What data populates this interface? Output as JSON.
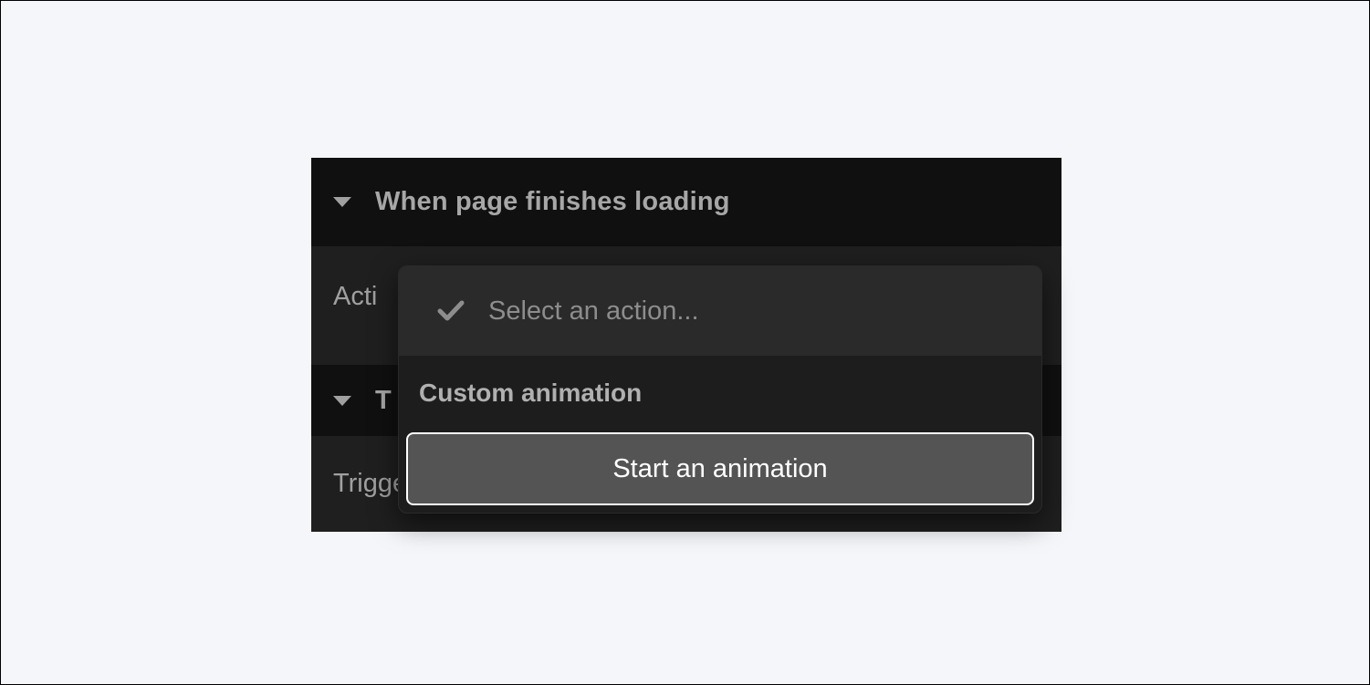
{
  "panel": {
    "section1": {
      "title": "When page finishes loading",
      "body_label": "Acti"
    },
    "section2": {
      "title": "T",
      "body_label": "Trigger on"
    }
  },
  "dropdown": {
    "placeholder": "Select an action...",
    "group_label": "Custom animation",
    "highlighted_option": "Start an animation"
  }
}
